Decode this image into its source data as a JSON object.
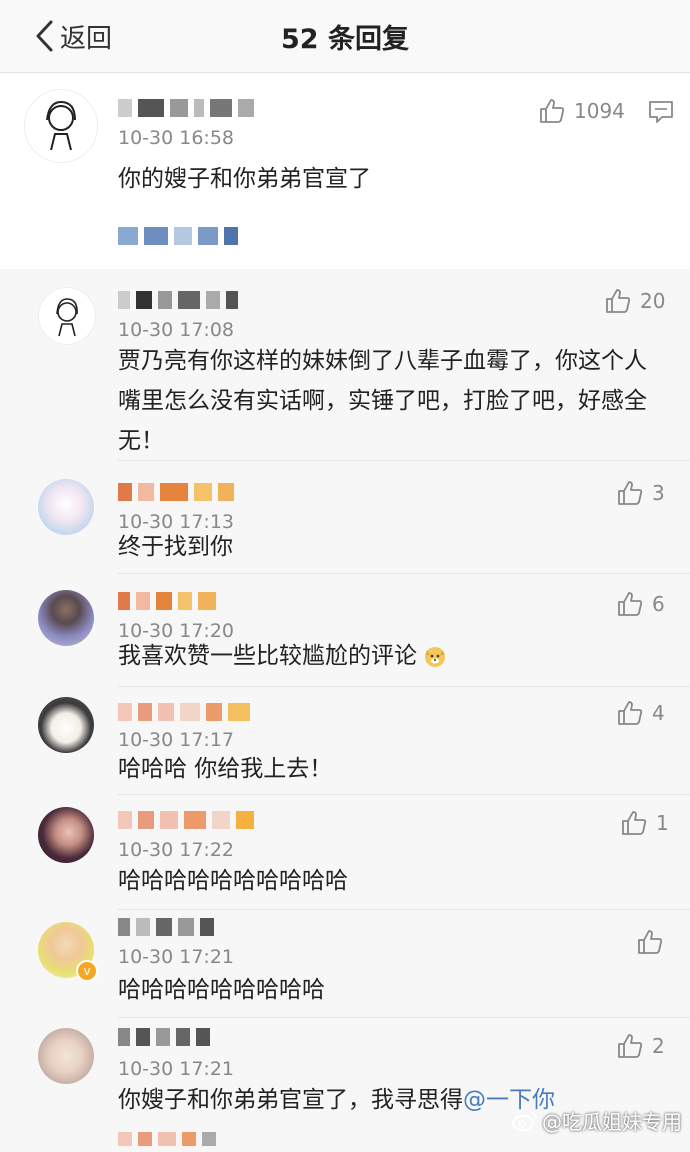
{
  "header": {
    "back_label": "返回",
    "title": "52 条回复"
  },
  "main_comment": {
    "time": "10-30 16:58",
    "likes": "1094",
    "text": "你的嫂子和你弟弟官宣了"
  },
  "replies": [
    {
      "time": "10-30 17:08",
      "likes": "20",
      "text": "贾乃亮有你这样的妹妹倒了八辈子血霉了，你这个人嘴里怎么没有实话啊，实锤了吧，打脸了吧，好感全无！"
    },
    {
      "time": "10-30 17:13",
      "likes": "3",
      "text": "终于找到你"
    },
    {
      "time": "10-30 17:20",
      "likes": "6",
      "text": "我喜欢赞一些比较尴尬的评论"
    },
    {
      "time": "10-30 17:17",
      "likes": "4",
      "text": "哈哈哈 你给我上去！"
    },
    {
      "time": "10-30 17:22",
      "likes": "1",
      "text": "哈哈哈哈哈哈哈哈哈哈"
    },
    {
      "time": "10-30 17:21",
      "likes": "",
      "text": "哈哈哈哈哈哈哈哈哈"
    },
    {
      "time": "10-30 17:21",
      "likes": "2",
      "text": "你嫂子和你弟弟官宣了，我寻思得",
      "mention": "@一下你"
    }
  ],
  "watermark": "@吃瓜姐妹专用",
  "icons": {
    "back": "chevron-left-icon",
    "like": "thumbs-up-icon",
    "reply": "comment-icon"
  }
}
